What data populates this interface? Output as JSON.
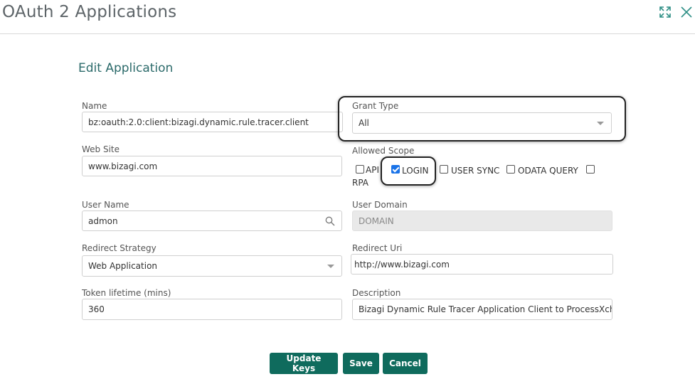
{
  "window": {
    "title": "OAuth 2 Applications"
  },
  "form": {
    "heading": "Edit Application",
    "name": {
      "label": "Name",
      "value": "bz:oauth:2.0:client:bizagi.dynamic.rule.tracer.client"
    },
    "grant_type": {
      "label": "Grant Type",
      "value": "All"
    },
    "web_site": {
      "label": "Web Site",
      "value": "www.bizagi.com"
    },
    "allowed_scope": {
      "label": "Allowed Scope",
      "options": [
        {
          "label": "API",
          "checked": false
        },
        {
          "label": "LOGIN",
          "checked": true
        },
        {
          "label": "USER SYNC",
          "checked": false
        },
        {
          "label": "ODATA QUERY",
          "checked": false
        },
        {
          "label": "RPA",
          "checked": false
        }
      ]
    },
    "user_name": {
      "label": "User Name",
      "value": "admon"
    },
    "user_domain": {
      "label": "User Domain",
      "value": "DOMAIN"
    },
    "redirect_strategy": {
      "label": "Redirect Strategy",
      "value": "Web Application"
    },
    "redirect_uri": {
      "label": "Redirect Uri",
      "value": "http://www.bizagi.com"
    },
    "token_lifetime": {
      "label": "Token lifetime (mins)",
      "value": "360"
    },
    "description": {
      "label": "Description",
      "value": "Bizagi Dynamic Rule Tracer Application Client to ProcessXchange"
    }
  },
  "buttons": {
    "update_keys": "Update Keys",
    "save": "Save",
    "cancel": "Cancel"
  },
  "icons": {
    "expand": "expand-icon",
    "close": "close-icon",
    "search": "search-icon",
    "dropdown": "chevron-down-icon"
  },
  "colors": {
    "accent": "#0f6b5d",
    "heading": "#2b6a6a",
    "checkbox": "#1a73e8"
  }
}
